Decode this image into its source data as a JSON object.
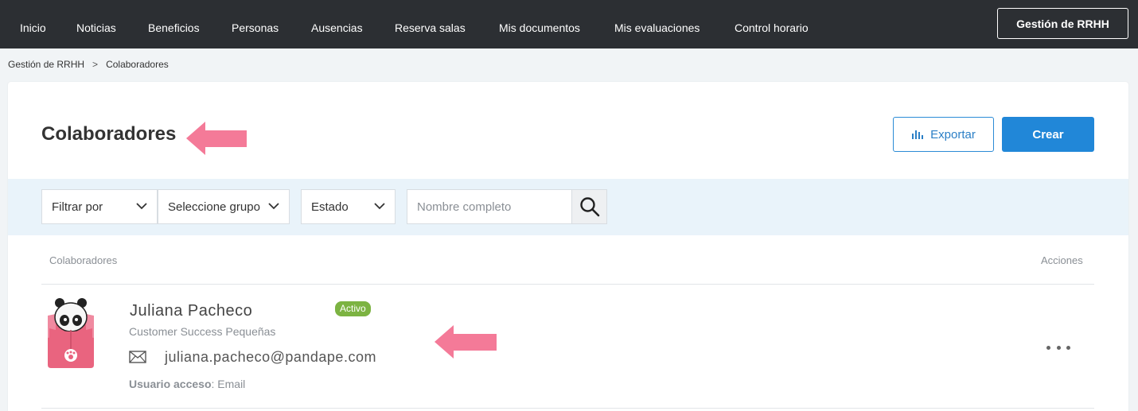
{
  "nav": {
    "items": [
      "Inicio",
      "Noticias",
      "Beneficios",
      "Personas",
      "Ausencias",
      "Reserva salas",
      "Mis documentos",
      "Mis evaluaciones",
      "Control horario"
    ],
    "rrhh_button": "Gestión de RRHH"
  },
  "breadcrumb": {
    "root": "Gestión de RRHH",
    "separator": ">",
    "current": "Colaboradores"
  },
  "page": {
    "title": "Colaboradores",
    "export_label": "Exportar",
    "create_label": "Crear"
  },
  "filters": {
    "filter_by": "Filtrar por",
    "group": "Seleccione grupo",
    "status": "Estado",
    "search_placeholder": "Nombre completo"
  },
  "table": {
    "col_collaborators": "Colaboradores",
    "col_actions": "Acciones",
    "rows": [
      {
        "name": "Juliana Pacheco",
        "status": "Activo",
        "role": "Customer Success Pequeñas",
        "email": "juliana.pacheco@pandape.com",
        "access_label": "Usuario acceso",
        "access_value": ": Email"
      }
    ]
  },
  "colors": {
    "nav_bg": "#2c2f33",
    "accent_blue": "#2187d8",
    "badge_green": "#7cb342",
    "arrow_pink": "#f47a98",
    "filter_bg": "#e9f3fa"
  },
  "icons": [
    "bar-chart-icon",
    "chevron-down-icon",
    "search-icon",
    "mail-icon",
    "more-dots-icon",
    "panda-avatar"
  ]
}
